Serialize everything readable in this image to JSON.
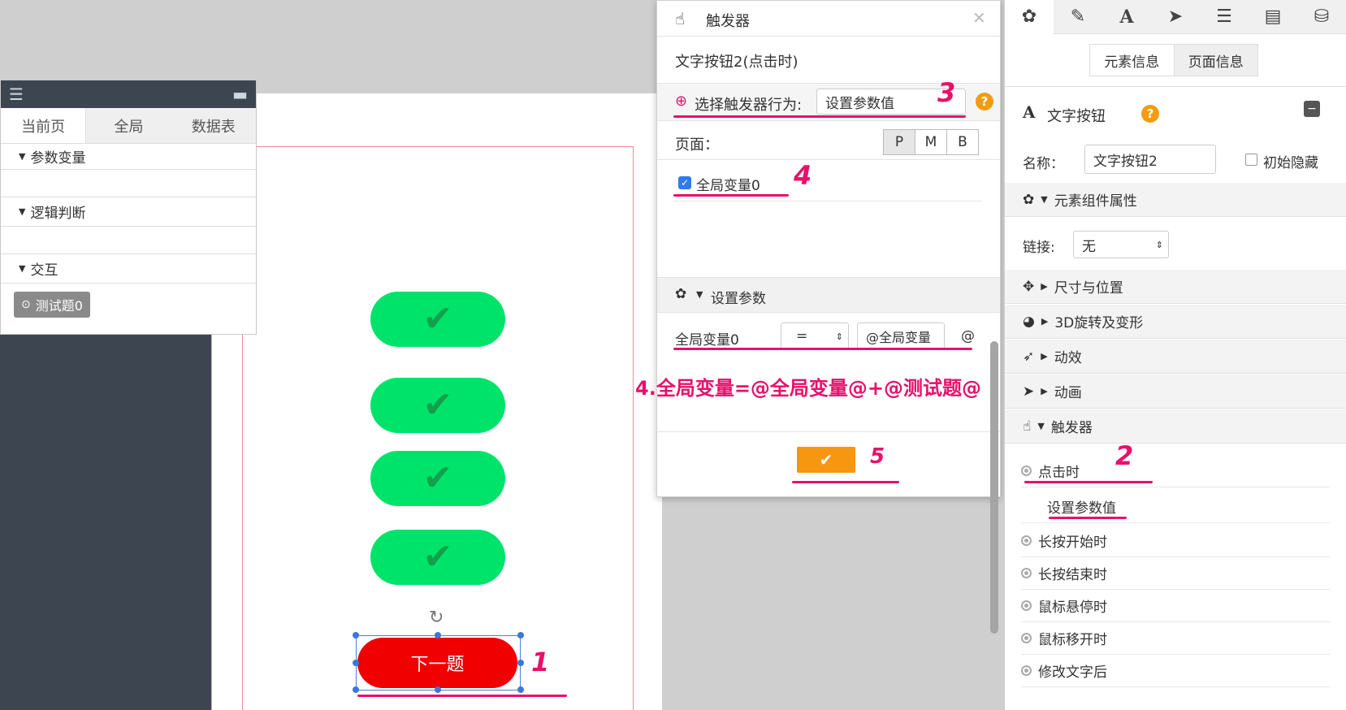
{
  "left_panel": {
    "tabs": [
      "当前页",
      "全局",
      "数据表"
    ],
    "sections": [
      "参数变量",
      "逻辑判断",
      "交互"
    ],
    "chip_label": "测试题0"
  },
  "canvas": {
    "next_button_label": "下一题"
  },
  "dialog": {
    "title": "触发器",
    "subtitle": "文字按钮2(点击时)",
    "action_label": "选择触发器行为:",
    "action_value": "设置参数值",
    "page_label": "页面：",
    "page_options": [
      "P",
      "M",
      "B"
    ],
    "checkbox_label": "全局变量0",
    "params_section": "设置参数",
    "param_name": "全局变量0",
    "param_op": "=",
    "param_value": "@全局变量",
    "param_tail": "@",
    "formula_note": "4.全局变量=@全局变量@+@测试题@"
  },
  "right_panel": {
    "subtabs": [
      "元素信息",
      "页面信息"
    ],
    "element_type": "文字按钮",
    "name_label": "名称：",
    "name_value": "文字按钮2",
    "hidden_label": "初始隐藏",
    "component_section": "元素组件属性",
    "link_label": "链接:",
    "link_value": "无",
    "sections": [
      "尺寸与位置",
      "3D旋转及变形",
      "动效",
      "动画",
      "触发器"
    ],
    "trigger_items": [
      "点击时",
      "设置参数值",
      "长按开始时",
      "长按结束时",
      "鼠标悬停时",
      "鼠标移开时",
      "修改文字后"
    ]
  },
  "annotations": [
    "1",
    "2",
    "3",
    "4",
    "5"
  ],
  "colors": {
    "accent_pink": "#e8106a",
    "green_button": "#00e36b",
    "red_button": "#f00000",
    "orange": "#f29c11"
  }
}
